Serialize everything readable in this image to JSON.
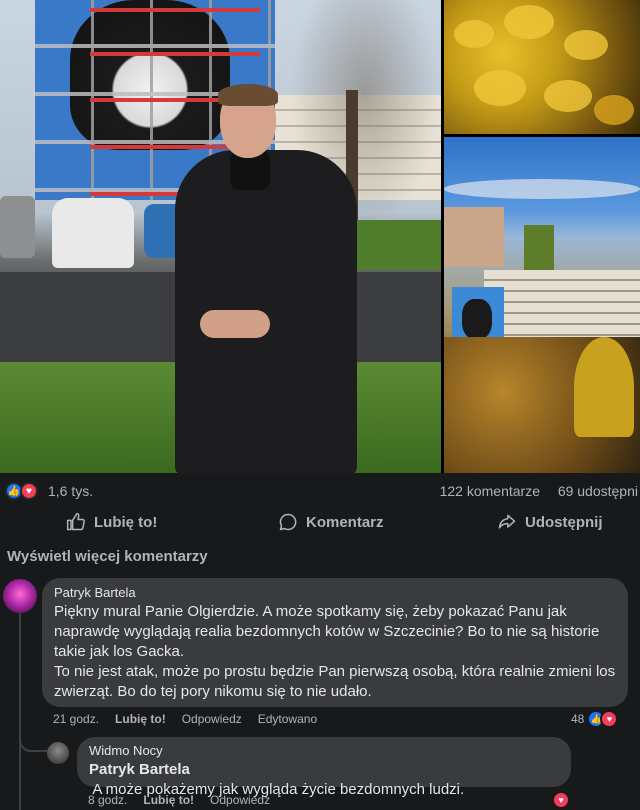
{
  "post": {
    "reactions_count": "1,6 tys.",
    "comments_count": "122 komentarze",
    "shares_count": "69 udostępni",
    "actions": {
      "like": "Lubię to!",
      "comment": "Komentarz",
      "share": "Udostępnij"
    }
  },
  "view_more_comments": "Wyświetl więcej komentarzy",
  "comments": [
    {
      "author": "Patryk Bartela",
      "text": "Piękny mural Panie Olgierdzie. A może spotkamy się, żeby pokazać Panu jak naprawdę wyglądają realia bezdomnych kotów w Szczecinie? Bo to nie są historie takie jak los Gacka.\nTo nie jest atak, może po prostu będzie Pan pierwszą osobą, która realnie zmieni los zwierząt. Bo do tej pory nikomu się to nie udało.",
      "time": "21 godz.",
      "like": "Lubię to!",
      "reply": "Odpowiedz",
      "edited": "Edytowano",
      "reactions": "48",
      "replies": [
        {
          "author": "Widmo Nocy",
          "mention": "Patryk Bartela",
          "text": " A może pokażemy jak wygląda życie bezdomnych ludzi.",
          "time": "8 godz.",
          "like": "Lubię to!",
          "reply": "Odpowiedz"
        }
      ]
    }
  ],
  "colors": {
    "background": "#18191a",
    "bubble": "#3a3b3c",
    "text": "#e4e6eb",
    "muted": "#b0b3b8",
    "like_blue": "#1877f2",
    "love_red": "#f33e58"
  },
  "icons": [
    "like-reaction-icon",
    "love-reaction-icon",
    "thumbs-up-icon",
    "comment-icon",
    "share-icon"
  ]
}
